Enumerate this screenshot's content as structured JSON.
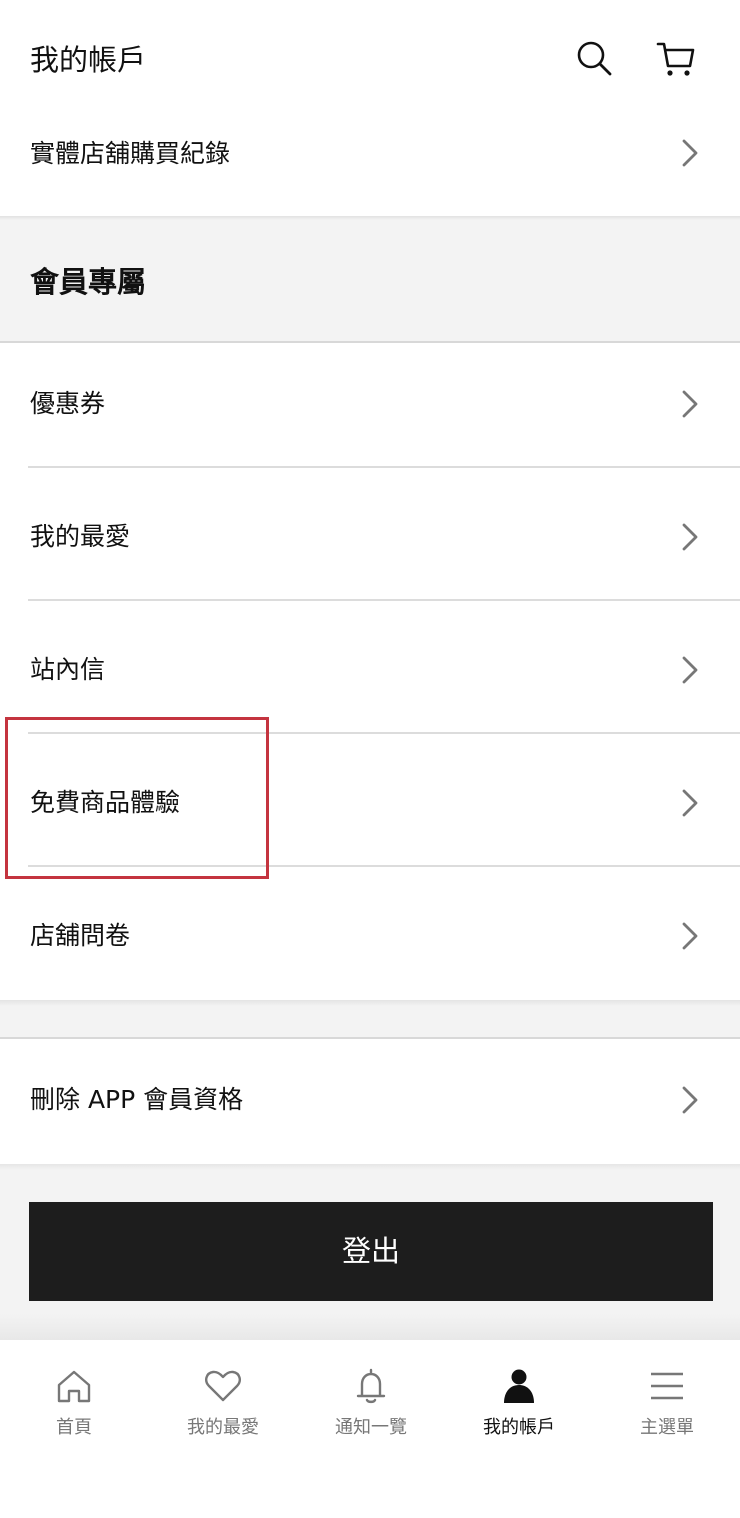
{
  "header": {
    "title": "我的帳戶",
    "search_icon": "search-icon",
    "cart_icon": "cart-icon"
  },
  "rows": {
    "store_history": "實體店舖購買紀錄",
    "coupons": "優惠券",
    "favorites": "我的最愛",
    "inbox": "站內信",
    "free_trial": "免費商品體驗",
    "survey": "店舖問卷",
    "delete_membership": "刪除 APP 會員資格"
  },
  "section": {
    "member_title": "會員專屬"
  },
  "logout_label": "登出",
  "bottom_nav": {
    "home": "首頁",
    "favorites": "我的最愛",
    "notifications": "通知一覽",
    "account": "我的帳戶",
    "menu": "主選單"
  },
  "colors": {
    "highlight": "#c4343f",
    "button_bg": "#1d1d1d",
    "section_bg": "#f3f3f3",
    "inactive_nav": "#777777"
  }
}
